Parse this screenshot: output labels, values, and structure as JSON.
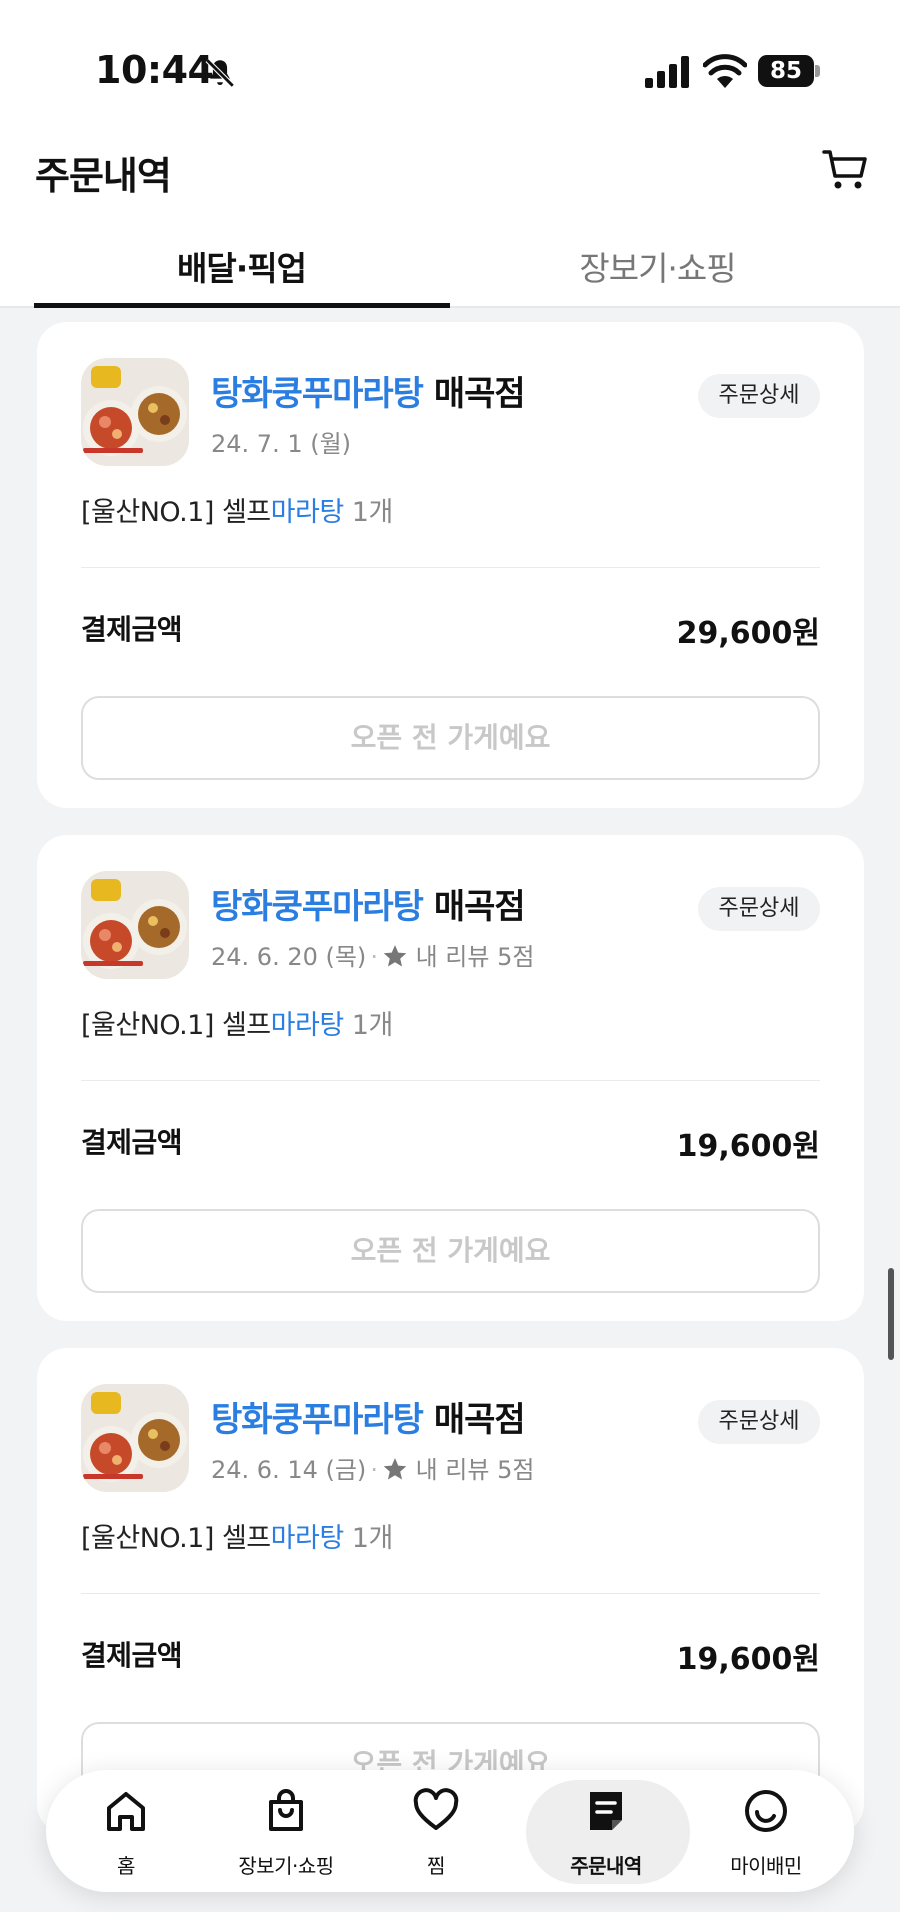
{
  "status_bar": {
    "time": "10:44",
    "battery": "85"
  },
  "header": {
    "title": "주문내역"
  },
  "tabs": [
    {
      "label": "배달·픽업",
      "active": true
    },
    {
      "label": "장보기·쇼핑",
      "active": false
    }
  ],
  "orders": [
    {
      "store_highlight": "탕화쿵푸마라탕",
      "store_branch": "매곡점",
      "date": "24. 7. 1 (월)",
      "review": "",
      "detail_label": "주문상세",
      "menu_prefix": "[울산NO.1] 셀프",
      "menu_highlight": "마라탕",
      "menu_qty": "1개",
      "pay_label": "결제금액",
      "amount": "29,600원",
      "closed_label": "오픈 전 가게예요"
    },
    {
      "store_highlight": "탕화쿵푸마라탕",
      "store_branch": "매곡점",
      "date": "24. 6. 20 (목)",
      "review": "내 리뷰 5점",
      "detail_label": "주문상세",
      "menu_prefix": "[울산NO.1] 셀프",
      "menu_highlight": "마라탕",
      "menu_qty": "1개",
      "pay_label": "결제금액",
      "amount": "19,600원",
      "closed_label": "오픈 전 가게예요"
    },
    {
      "store_highlight": "탕화쿵푸마라탕",
      "store_branch": "매곡점",
      "date": "24. 6. 14 (금)",
      "review": "내 리뷰 5점",
      "detail_label": "주문상세",
      "menu_prefix": "[울산NO.1] 셀프",
      "menu_highlight": "마라탕",
      "menu_qty": "1개",
      "pay_label": "결제금액",
      "amount": "19,600원",
      "closed_label": "오픈 전 가게예요"
    }
  ],
  "bottom_nav": [
    {
      "label": "홈",
      "icon": "home-icon"
    },
    {
      "label": "장보기·쇼핑",
      "icon": "shopping-bag-icon"
    },
    {
      "label": "찜",
      "icon": "heart-icon"
    },
    {
      "label": "주문내역",
      "icon": "receipt-icon",
      "active": true
    },
    {
      "label": "마이배민",
      "icon": "smile-icon"
    }
  ],
  "colors": {
    "accent": "#2a7de1",
    "background": "#f2f3f5"
  }
}
